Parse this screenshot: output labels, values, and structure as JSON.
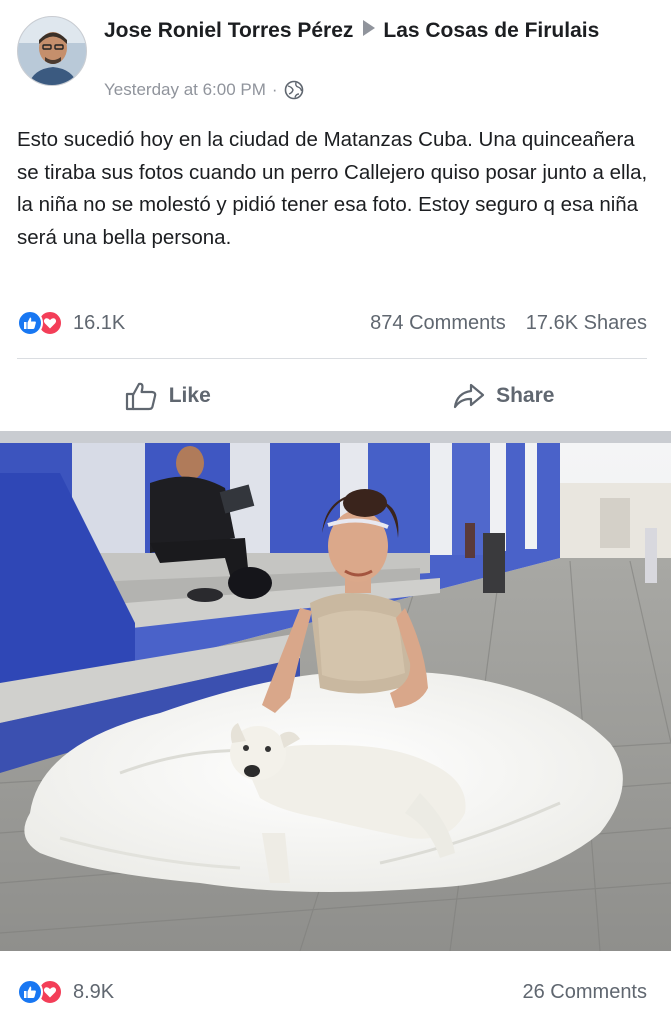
{
  "post": {
    "author": "Jose Roniel Torres Pérez",
    "group": "Las Cosas de Firulais",
    "timestamp": "Yesterday at 6:00 PM",
    "meta_separator": "·",
    "privacy_icon": "globe-icon",
    "text": "Esto sucedió hoy en la ciudad de Matanzas Cuba. Una quinceañera se tiraba sus fotos cuando un perro Callejero quiso posar junto a ella, la niña no se molestó y pidió tener esa foto. Estoy seguro q esa niña será una bella persona."
  },
  "stats": {
    "reactions_count": "16.1K",
    "comments": "874 Comments",
    "shares": "17.6K Shares"
  },
  "actions": {
    "like_label": "Like",
    "share_label": "Share"
  },
  "photo_stats": {
    "reactions_count": "8.9K",
    "comments": "26 Comments"
  },
  "colors": {
    "like_blue": "#1877f2",
    "love_red": "#f33e58",
    "secondary_text": "#606770",
    "meta_text": "#90949c"
  }
}
